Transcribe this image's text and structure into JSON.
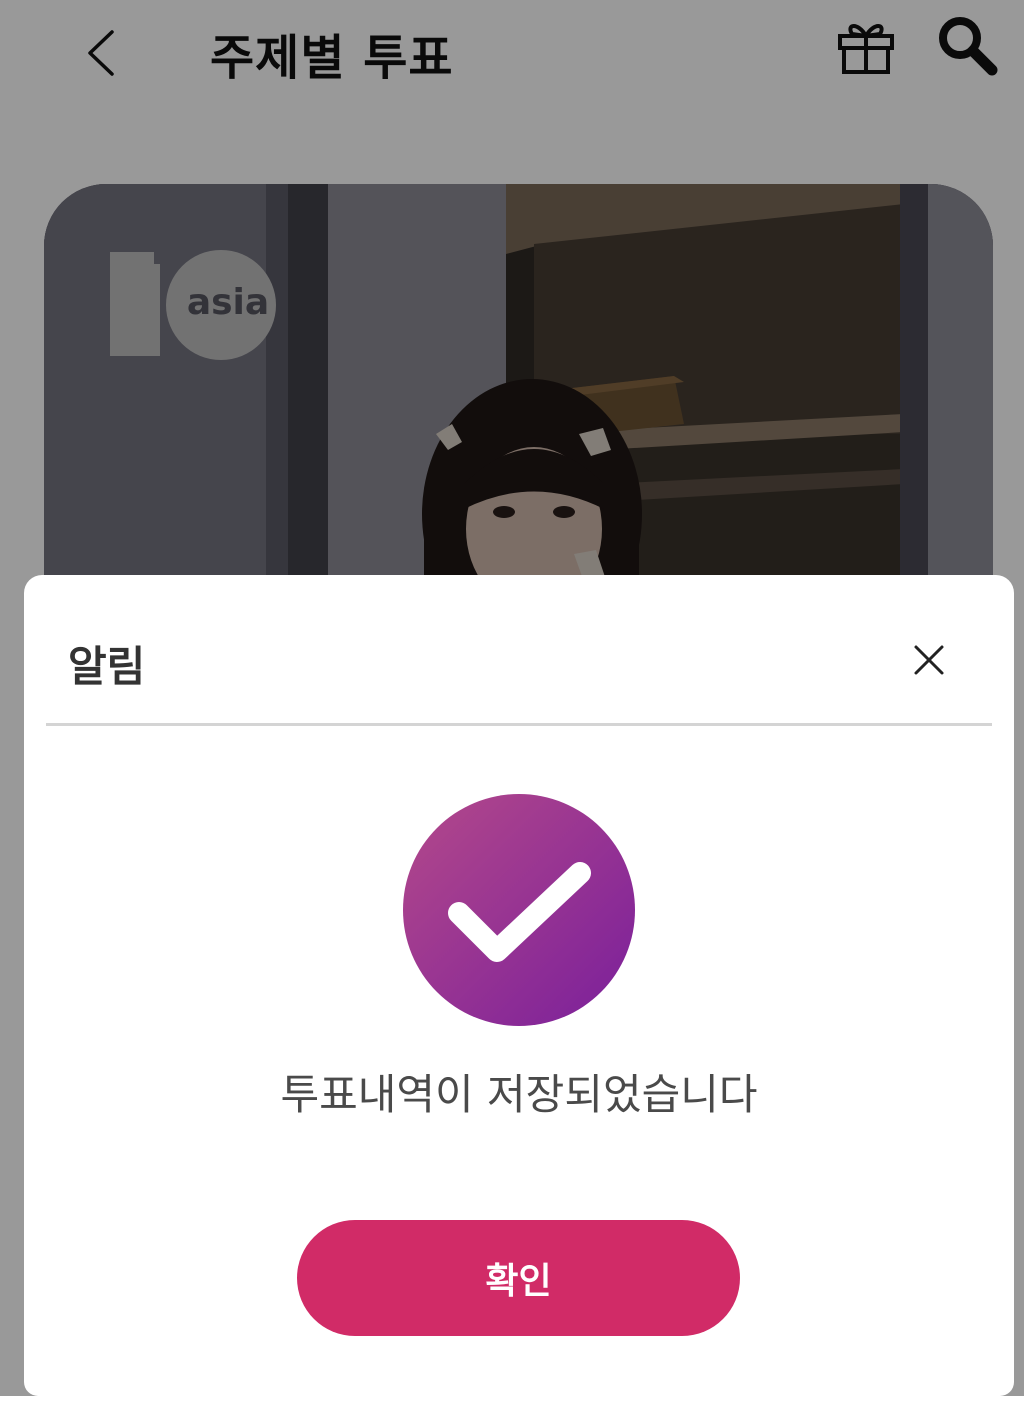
{
  "header": {
    "title": "주제별 투표",
    "back_icon": "chevron-left-icon",
    "gift_icon": "gift-icon",
    "search_icon": "search-icon"
  },
  "banner": {
    "logo_text_number": "1",
    "logo_text_asia": "asia",
    "logo_alt": "10asia"
  },
  "dialog": {
    "title": "알림",
    "close_icon": "close-icon",
    "status_icon": "check-circle-icon",
    "message": "투표내역이 저장되었습니다",
    "confirm_label": "확인"
  },
  "colors": {
    "accent": "#d12b67",
    "check_gradient_start": "#b4498a",
    "check_gradient_end": "#7a1f9b",
    "overlay": "rgba(0,0,0,0.40)"
  }
}
